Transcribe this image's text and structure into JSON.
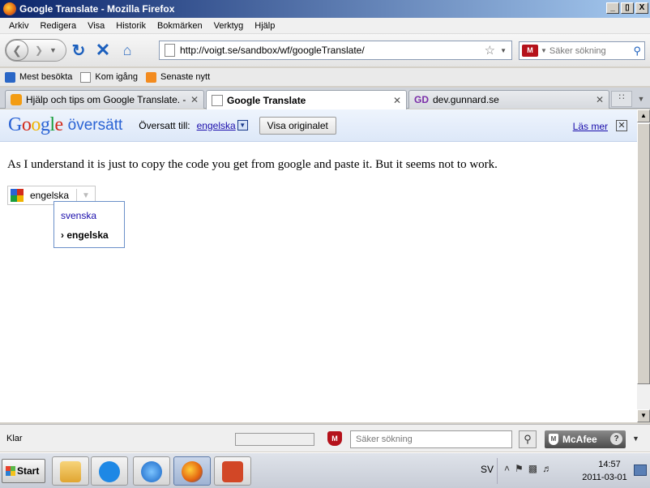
{
  "window": {
    "title": "Google Translate - Mozilla Firefox",
    "minimize": "_",
    "maximize": "▯",
    "close": "X"
  },
  "menu": [
    "Arkiv",
    "Redigera",
    "Visa",
    "Historik",
    "Bokmärken",
    "Verktyg",
    "Hjälp"
  ],
  "nav": {
    "url": "http://voigt.se/sandbox/wf/googleTranslate/",
    "search_placeholder": "Säker sökning"
  },
  "bookmarks": [
    "Mest besökta",
    "Kom igång",
    "Senaste nytt"
  ],
  "tabs": [
    {
      "label": "Hjälp och tips om Google Translate. - w...",
      "active": false
    },
    {
      "label": "Google Translate",
      "active": true
    },
    {
      "label": "dev.gunnard.se",
      "active": false
    }
  ],
  "translate_bar": {
    "logo_google": [
      "G",
      "o",
      "o",
      "g",
      "l",
      "e"
    ],
    "logo_suffix": "översätt",
    "translated_to": "Översatt till:",
    "language": "engelska",
    "show_original": "Visa originalet",
    "read_more": "Läs mer"
  },
  "page": {
    "paragraph": "As I understand it is just to copy the code you get from google and paste it. But it seems not to work.",
    "selector_value": "engelska",
    "dropdown_options": [
      "svenska",
      "› engelska"
    ]
  },
  "status": {
    "text": "Klar",
    "search_placeholder": "Säker sökning",
    "mcafee": "McAfee"
  },
  "taskbar": {
    "start": "Start",
    "lang": "SV",
    "time": "14:57",
    "date": "2011-03-01"
  }
}
